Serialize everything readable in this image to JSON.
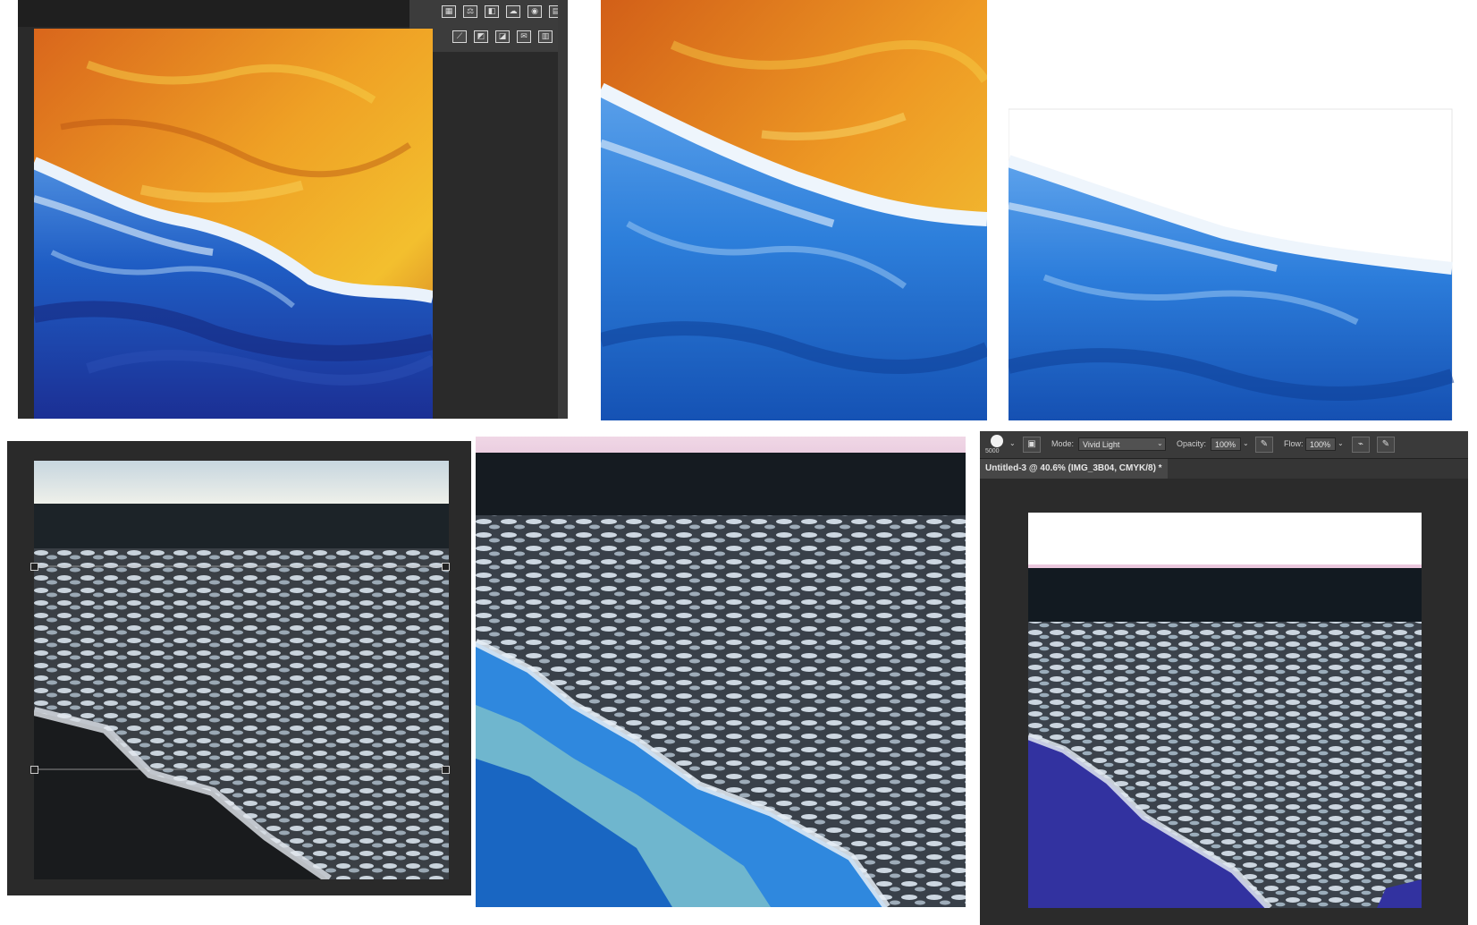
{
  "photoshop_window": {
    "tool_icons": [
      "grid-icon",
      "balance-icon",
      "panel-icon",
      "cloud-icon",
      "globe-icon",
      "table-icon",
      "curve-icon",
      "layers-icon",
      "levels-icon",
      "mail-icon",
      "gradient-icon"
    ]
  },
  "options_bar": {
    "brush_size": "5000",
    "mode_label": "Mode:",
    "mode_value": "Vivid Light",
    "opacity_label": "Opacity:",
    "opacity_value": "100%",
    "flow_label": "Flow:",
    "flow_value": "100%"
  },
  "document": {
    "tab_title": "Untitled-3 @ 40.6% (IMG_3B04, CMYK/8) *"
  },
  "colors": {
    "orange": "#e2731b",
    "yellow": "#f2b52a",
    "blue_deep": "#1a46a8",
    "blue_bright": "#2f7fd8",
    "foam": "#dfeaf5",
    "indigo": "#3232a0"
  }
}
